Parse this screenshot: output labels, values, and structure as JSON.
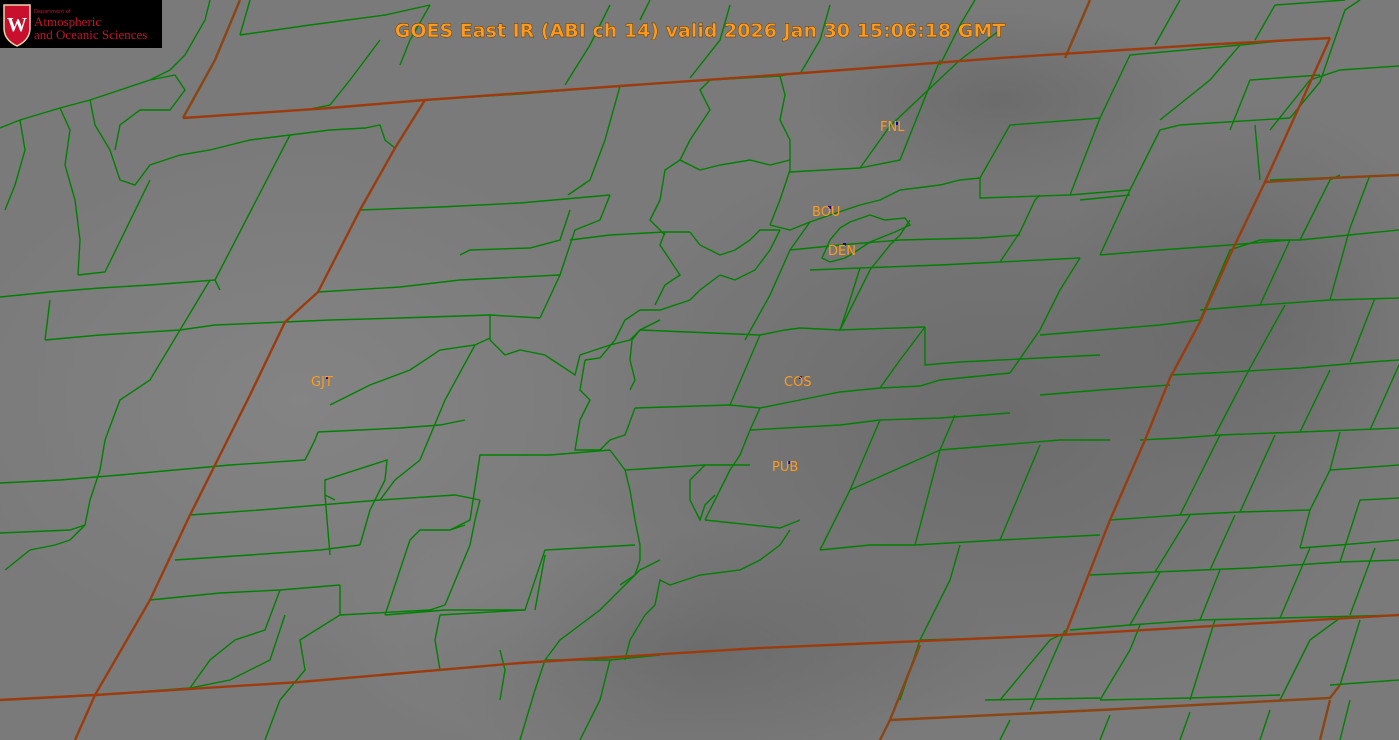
{
  "title": "GOES East IR (ABI ch 14) valid 2026 Jan 30 15:06:18 GMT",
  "logo": {
    "dept": "Department of",
    "line1": "Atmospheric",
    "line2": "and Oceanic Sciences",
    "crest_letter": "W"
  },
  "stations": [
    {
      "id": "FNL"
    },
    {
      "id": "BOU"
    },
    {
      "id": "DEN"
    },
    {
      "id": "GJT"
    },
    {
      "id": "COS"
    },
    {
      "id": "PUB"
    }
  ],
  "colors": {
    "background": "#7a7a7a",
    "title": "#ff9a1a",
    "station_label": "#ff9a1a",
    "county_border": "#008000",
    "state_border": "#8b4513",
    "station_marker": "#0000cc"
  }
}
